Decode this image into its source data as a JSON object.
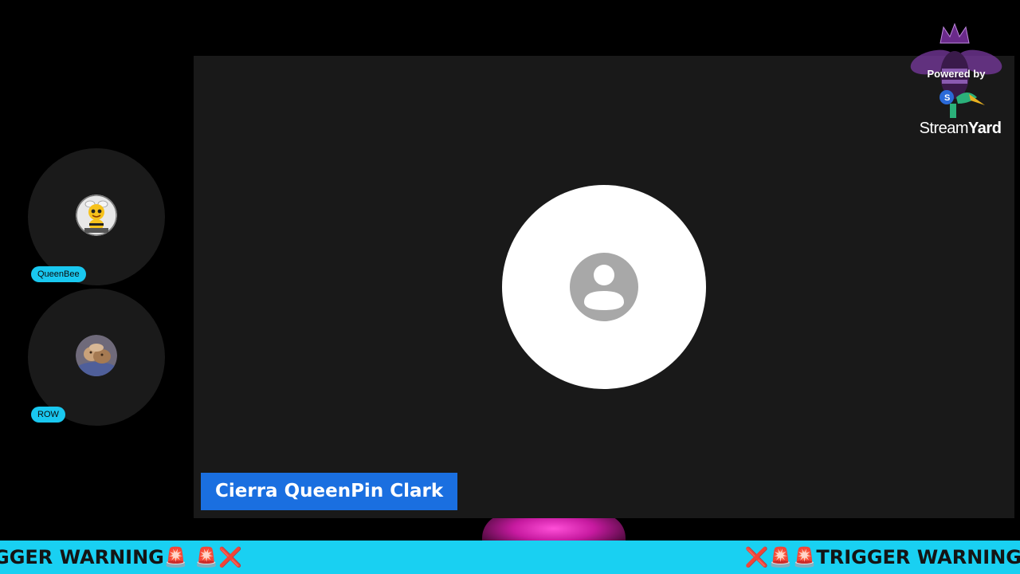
{
  "main_speaker": {
    "name": "Cierra QueenPin Clark",
    "name_plate_color": "#1a6fe0",
    "avatar_icon": "default-user-icon"
  },
  "participants": [
    {
      "name": "QueenBee",
      "avatar_icon": "bee-avatar"
    },
    {
      "name": "ROW",
      "avatar_icon": "photo-avatar"
    }
  ],
  "branding": {
    "powered_by": "Powered by",
    "stream": "Stream",
    "yard": "Yard",
    "logo_icon": "crowned-bee-logo"
  },
  "ticker": {
    "left_text": "GGER WARNING🚨 🚨❌",
    "right_text": "❌🚨🚨TRIGGER WARNING",
    "color": "#19d0f2"
  },
  "colors": {
    "background": "#000000",
    "tile": "#191919",
    "participant_label": "#19c8f0"
  }
}
